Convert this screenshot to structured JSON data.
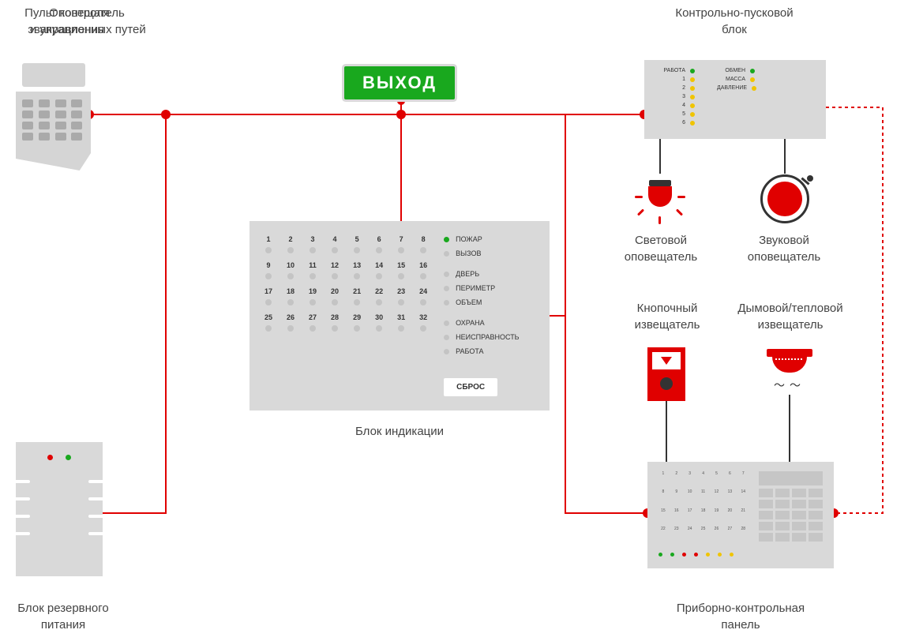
{
  "labels": {
    "keypad": "Пульт контроля\nи управления",
    "exit_notifier": "Оповещатель\nэвакуационных путей",
    "ctrl_launch": "Контрольно-пусковой\nблок",
    "indication": "Блок индикации",
    "backup_power": "Блок резервного\nпитания",
    "light_notifier": "Световой\nоповещатель",
    "sound_notifier": "Звуковой\nоповещатель",
    "button_detector": "Кнопочный\nизвещатель",
    "smoke_detector": "Дымовой/тепловой\nизвещатель",
    "control_panel": "Приборно-контрольная\nпанель"
  },
  "exit_sign_text": "ВЫХОД",
  "ctrl_block": {
    "left": [
      {
        "label": "РАБОТА",
        "led": "green"
      },
      {
        "label": "1",
        "led": "yellow"
      },
      {
        "label": "2",
        "led": "yellow"
      },
      {
        "label": "3",
        "led": "yellow"
      },
      {
        "label": "4",
        "led": "yellow"
      },
      {
        "label": "5",
        "led": "yellow"
      },
      {
        "label": "6",
        "led": "yellow"
      }
    ],
    "right": [
      {
        "label": "ОБМЕН",
        "led": "green"
      },
      {
        "label": "МАССА",
        "led": "yellow"
      },
      {
        "label": "ДАВЛЕНИЕ",
        "led": "yellow"
      }
    ]
  },
  "indication_block": {
    "zones": [
      1,
      2,
      3,
      4,
      5,
      6,
      7,
      8,
      9,
      10,
      11,
      12,
      13,
      14,
      15,
      16,
      17,
      18,
      19,
      20,
      21,
      22,
      23,
      24,
      25,
      26,
      27,
      28,
      29,
      30,
      31,
      32
    ],
    "statuses": [
      {
        "label": "ПОЖАР",
        "led": "green"
      },
      {
        "label": "ВЫЗОВ",
        "led": "off"
      },
      {
        "label": "ДВЕРЬ",
        "led": "off"
      },
      {
        "label": "ПЕРИМЕТР",
        "led": "off"
      },
      {
        "label": "ОБЪЕМ",
        "led": "off"
      },
      {
        "label": "ОХРАНА",
        "led": "off"
      },
      {
        "label": "НЕИСПРАВНОСТЬ",
        "led": "off"
      },
      {
        "label": "РАБОТА",
        "led": "off"
      }
    ],
    "reset_button": "СБРОС"
  },
  "control_panel": {
    "zones": [
      1,
      2,
      3,
      4,
      5,
      6,
      7,
      8,
      9,
      10,
      11,
      12,
      13,
      14,
      15,
      16,
      17,
      18,
      19,
      20,
      21,
      22,
      23,
      24,
      25,
      26,
      27,
      28
    ]
  },
  "colors": {
    "red": "#e00000",
    "green": "#19a81e",
    "yellow": "#f0c400",
    "device_bg": "#d9d9d9"
  }
}
